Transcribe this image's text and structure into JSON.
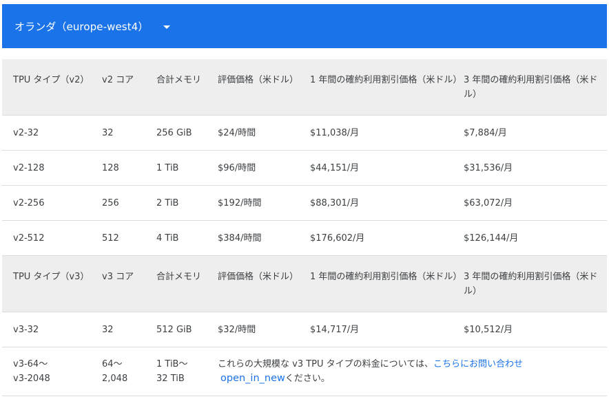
{
  "region": {
    "label": "オランダ（europe-west4）",
    "accent_color": "#1a73e8",
    "dropdown_icon": "arrow-drop-down-icon"
  },
  "v2_header": {
    "type": "TPU タイプ（v2）",
    "cores": "v2 コア",
    "memory": "合計メモリ",
    "eval_price": "評価価格（米ドル）",
    "one_year": "1 年間の確約利用割引価格（米ドル）",
    "three_year": "3 年間の確約利用割引価格（米ドル）"
  },
  "v2_rows": [
    {
      "type": "v2-32",
      "cores": "32",
      "memory": "256 GiB",
      "eval_price": "$24/時間",
      "one_year": "$11,038/月",
      "three_year": "$7,884/月"
    },
    {
      "type": "v2-128",
      "cores": "128",
      "memory": "1 TiB",
      "eval_price": "$96/時間",
      "one_year": "$44,151/月",
      "three_year": "$31,536/月"
    },
    {
      "type": "v2-256",
      "cores": "256",
      "memory": "2 TiB",
      "eval_price": "$192/時間",
      "one_year": "$88,301/月",
      "three_year": "$63,072/月"
    },
    {
      "type": "v2-512",
      "cores": "512",
      "memory": "4 TiB",
      "eval_price": "$384/時間",
      "one_year": "$176,602/月",
      "three_year": "$126,144/月"
    }
  ],
  "v3_header": {
    "type": "TPU タイプ（v3）",
    "cores": "v3 コア",
    "memory": "合計メモリ",
    "eval_price": "評価価格（米ドル）",
    "one_year": "1 年間の確約利用割引価格（米ドル）",
    "three_year": "3 年間の確約利用割引価格（米ドル）"
  },
  "v3_rows": [
    {
      "type": "v3-32",
      "cores": "32",
      "memory": "512 GiB",
      "eval_price": "$32/時間",
      "one_year": "$14,717/月",
      "three_year": "$10,512/月"
    }
  ],
  "v3_large": {
    "type_line1": "v3-64～",
    "type_line2": "v3-2048",
    "cores_line1": "64～",
    "cores_line2": "2,048",
    "memory_line1": "1 TiB～",
    "memory_line2": "32 TiB",
    "note_prefix": "これらの大規模な v3 TPU タイプの料金については、",
    "note_link": "こちらにお問い合わせ",
    "note_icon": "open_in_new",
    "note_suffix": "ください。"
  }
}
